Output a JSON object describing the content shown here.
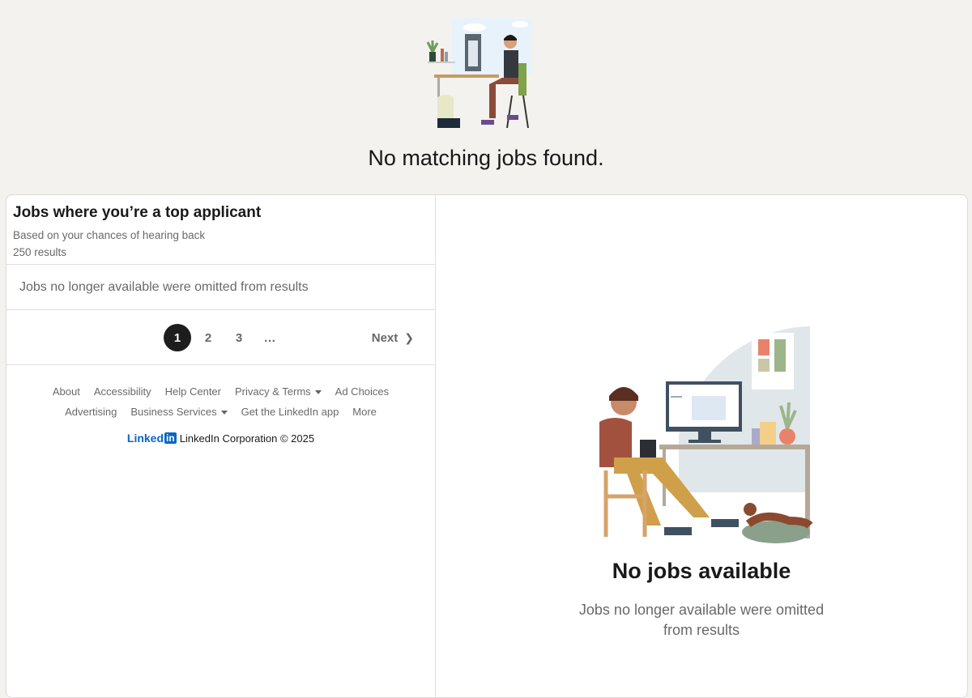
{
  "page": {
    "empty_title": "No matching jobs found."
  },
  "left_panel": {
    "title": "Jobs where you’re a top applicant",
    "subtitle": "Based on your chances of hearing back",
    "count": "250 results",
    "omitted_note": "Jobs no longer available were omitted from results"
  },
  "pagination": {
    "pages": [
      "1",
      "2",
      "3",
      "…"
    ],
    "active": "1",
    "next_label": "Next",
    "next_icon": "chevron-right-icon"
  },
  "footer": {
    "row1": [
      "About",
      "Accessibility",
      "Help Center",
      "Privacy & Terms",
      "Ad Choices"
    ],
    "row2": [
      "Advertising",
      "Business Services",
      "Get the LinkedIn app",
      "More"
    ],
    "logo": {
      "word": "Linked",
      "mark": "in"
    },
    "copyright": "LinkedIn Corporation © 2025"
  },
  "right_panel": {
    "title": "No jobs available",
    "subtitle": "Jobs no longer available were omitted from results"
  },
  "colors": {
    "accent": "#0a66c2",
    "background": "#f3f2ef",
    "active_page": "#1d1d1d"
  }
}
